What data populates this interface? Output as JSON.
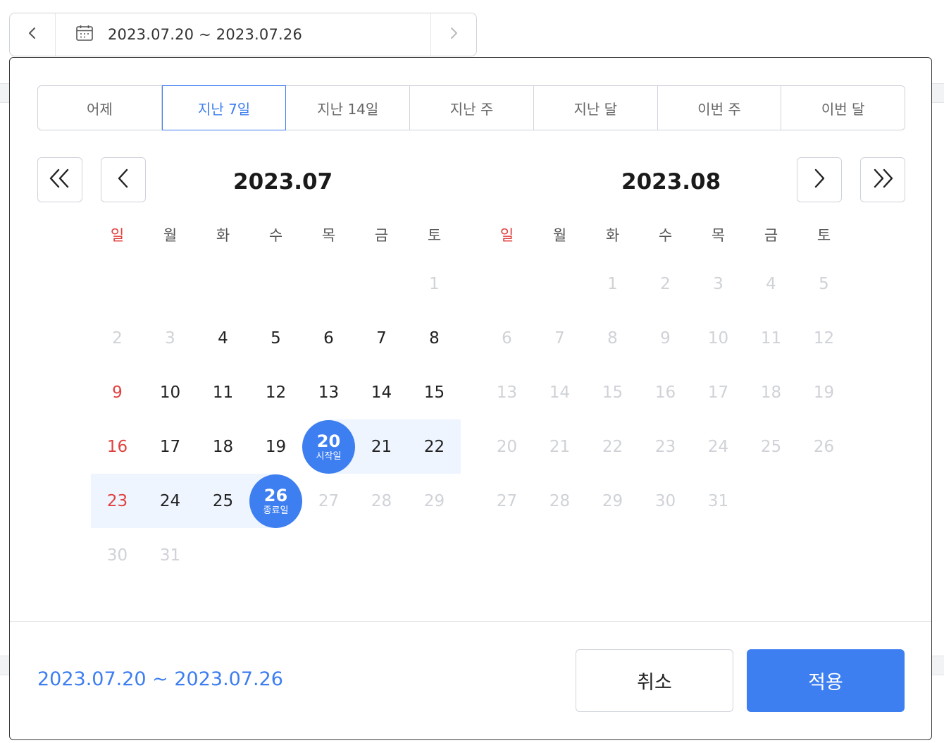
{
  "top_bar": {
    "range_text": "2023.07.20 ~ 2023.07.26",
    "prev_icon": "chevron-left-icon",
    "next_icon": "chevron-right-icon",
    "calendar_icon": "calendar-icon"
  },
  "presets": [
    {
      "label": "어제",
      "active": false
    },
    {
      "label": "지난 7일",
      "active": true
    },
    {
      "label": "지난 14일",
      "active": false
    },
    {
      "label": "지난 주",
      "active": false
    },
    {
      "label": "지난 달",
      "active": false
    },
    {
      "label": "이번 주",
      "active": false
    },
    {
      "label": "이번 달",
      "active": false
    }
  ],
  "weekdays": [
    "일",
    "월",
    "화",
    "수",
    "목",
    "금",
    "토"
  ],
  "months": [
    {
      "title": "2023.07",
      "cells": [
        "",
        "",
        "",
        "",
        "",
        "",
        "1",
        "2",
        "3",
        "4",
        "5",
        "6",
        "7",
        "8",
        "9",
        "10",
        "11",
        "12",
        "13",
        "14",
        "15",
        "16",
        "17",
        "18",
        "19",
        "20",
        "21",
        "22",
        "23",
        "24",
        "25",
        "26",
        "27",
        "28",
        "29",
        "30",
        "31"
      ],
      "enabled": [
        "4",
        "5",
        "6",
        "7",
        "8",
        "9",
        "10",
        "11",
        "12",
        "13",
        "14",
        "15",
        "16",
        "17",
        "18",
        "19",
        "20",
        "21",
        "22",
        "23",
        "24",
        "25",
        "26"
      ]
    },
    {
      "title": "2023.08",
      "cells": [
        "",
        "",
        "1",
        "2",
        "3",
        "4",
        "5",
        "6",
        "7",
        "8",
        "9",
        "10",
        "11",
        "12",
        "13",
        "14",
        "15",
        "16",
        "17",
        "18",
        "19",
        "20",
        "21",
        "22",
        "23",
        "24",
        "25",
        "26",
        "27",
        "28",
        "29",
        "30",
        "31"
      ],
      "enabled": []
    }
  ],
  "selection": {
    "start_day": "20",
    "start_label": "시작일",
    "end_day": "26",
    "end_label": "종료일"
  },
  "footer": {
    "summary": "2023.07.20 ~ 2023.07.26",
    "cancel_label": "취소",
    "apply_label": "적용"
  },
  "colors": {
    "accent": "#3d7ef0",
    "range_bg": "#eef5ff",
    "sunday": "#e0413e",
    "disabled": "#cfd2d7"
  }
}
